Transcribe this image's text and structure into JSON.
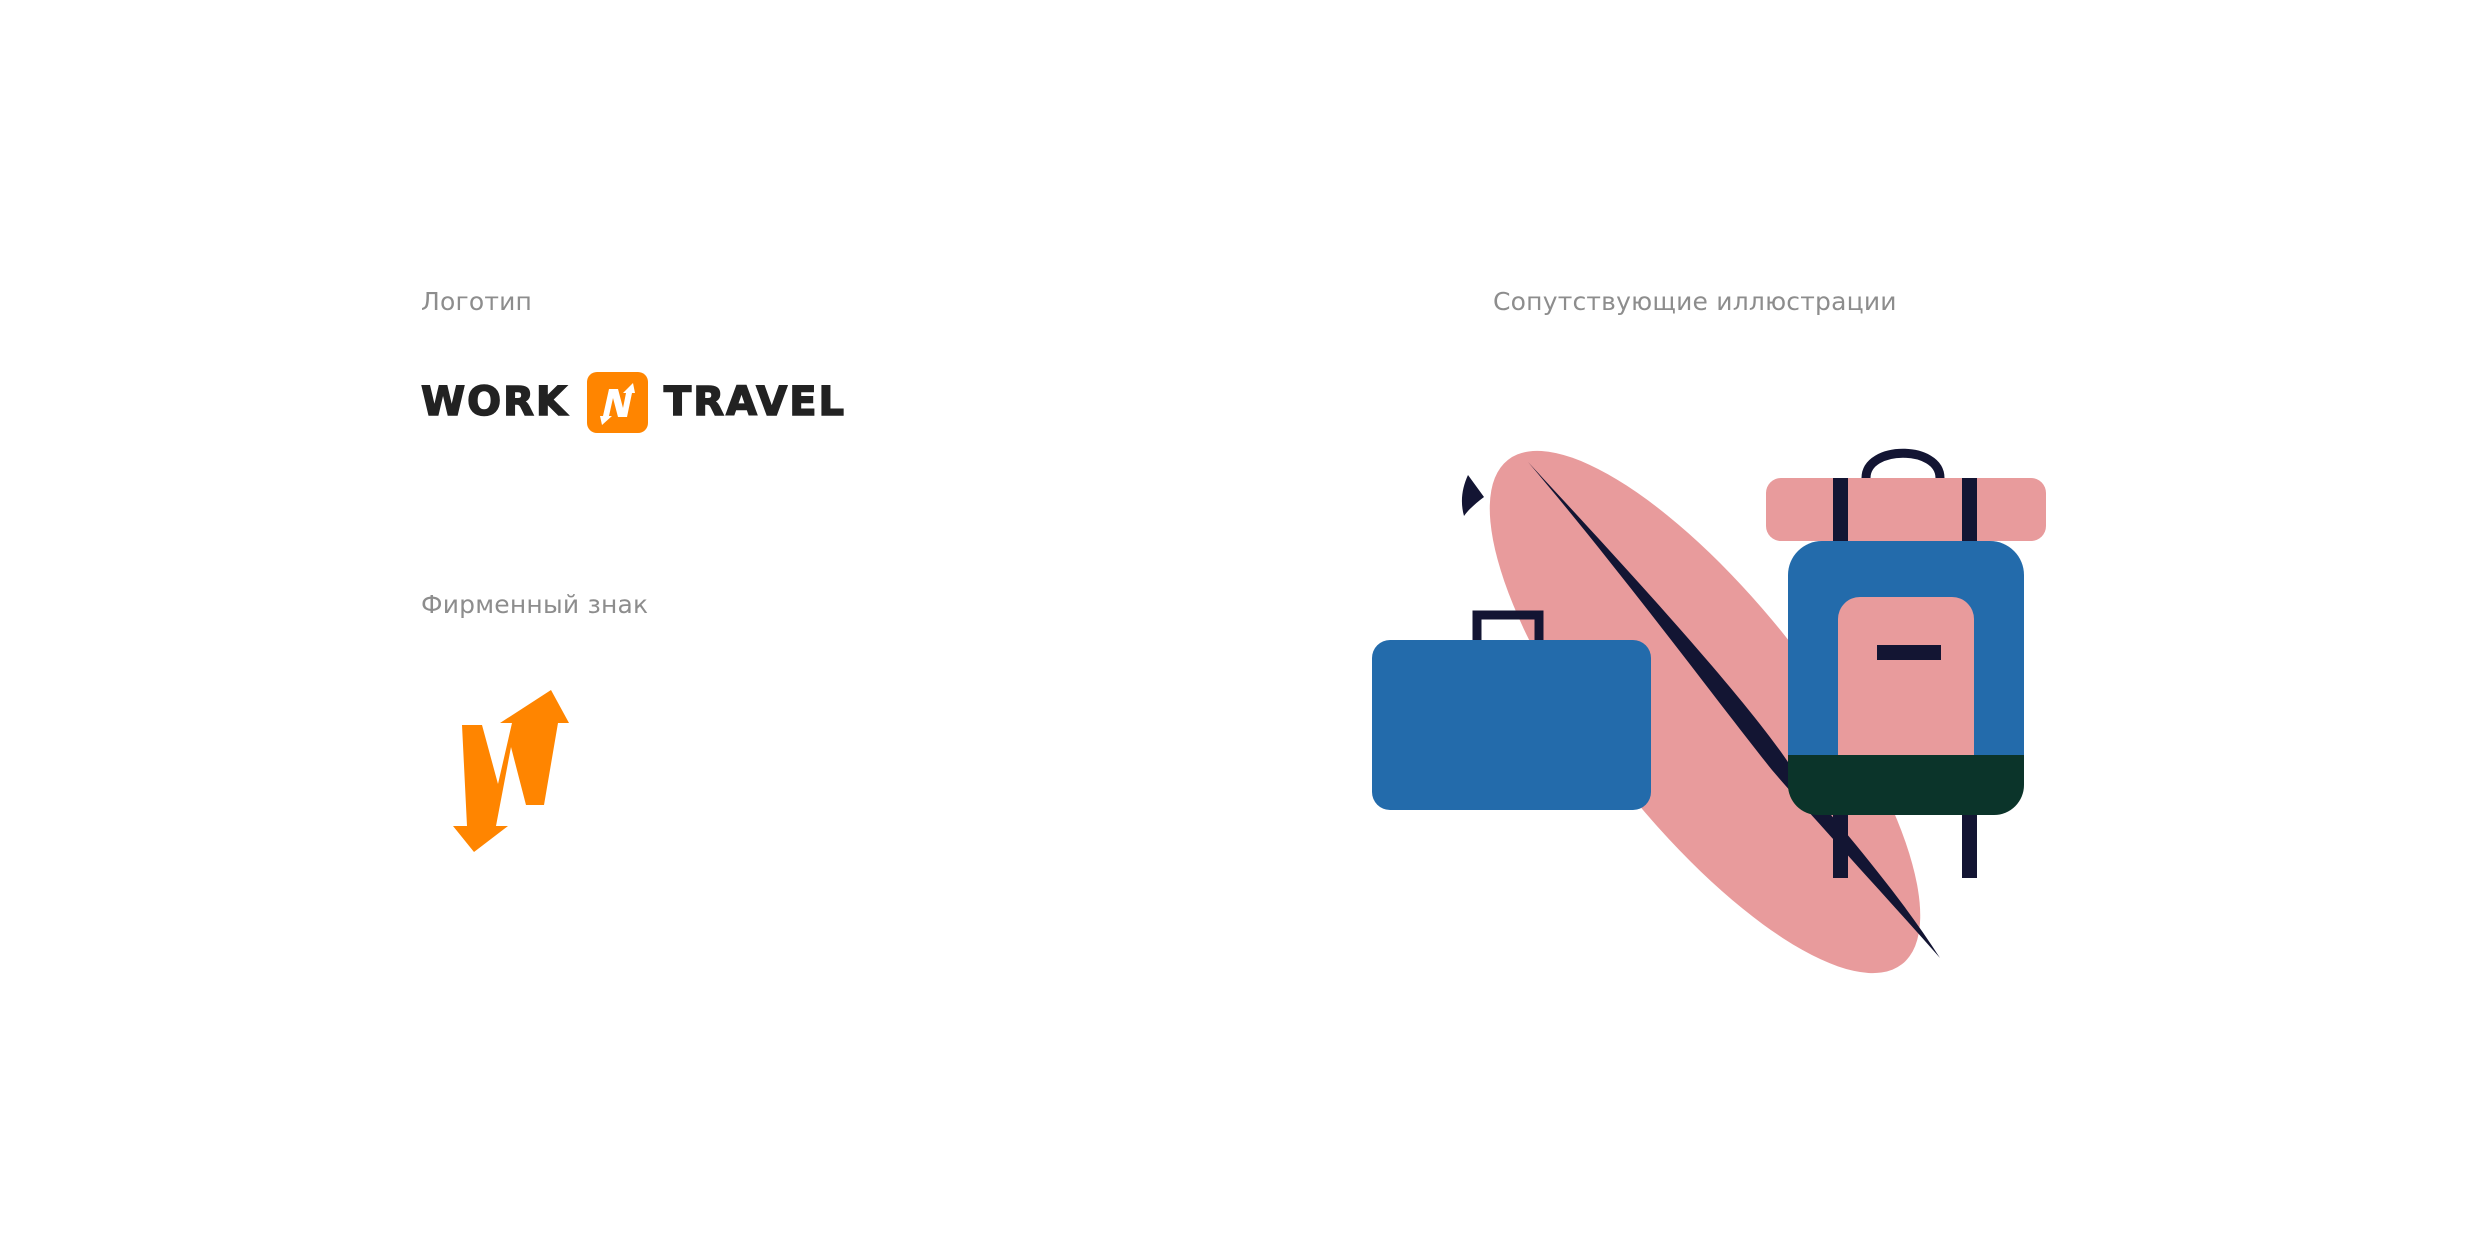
{
  "sections": {
    "logo_caption": "Логотип",
    "mark_caption": "Фирменный знак",
    "illustrations_caption": "Сопутствующие иллюстрации"
  },
  "logo": {
    "word_left": "WORK",
    "word_right": "TRAVEL"
  },
  "colors": {
    "brand_orange": "#FF8500",
    "text_dark": "#222222",
    "caption_gray": "#8D8D8D",
    "pink": "#E89B9C",
    "blue": "#236BAB",
    "navy": "#131533",
    "dark_green": "#0B342A"
  },
  "icons": {
    "badge": "n-arrows-badge-icon",
    "mark": "n-arrows-mark-icon",
    "illustration": [
      "surfboard-icon",
      "suitcase-icon",
      "backpack-icon"
    ]
  }
}
